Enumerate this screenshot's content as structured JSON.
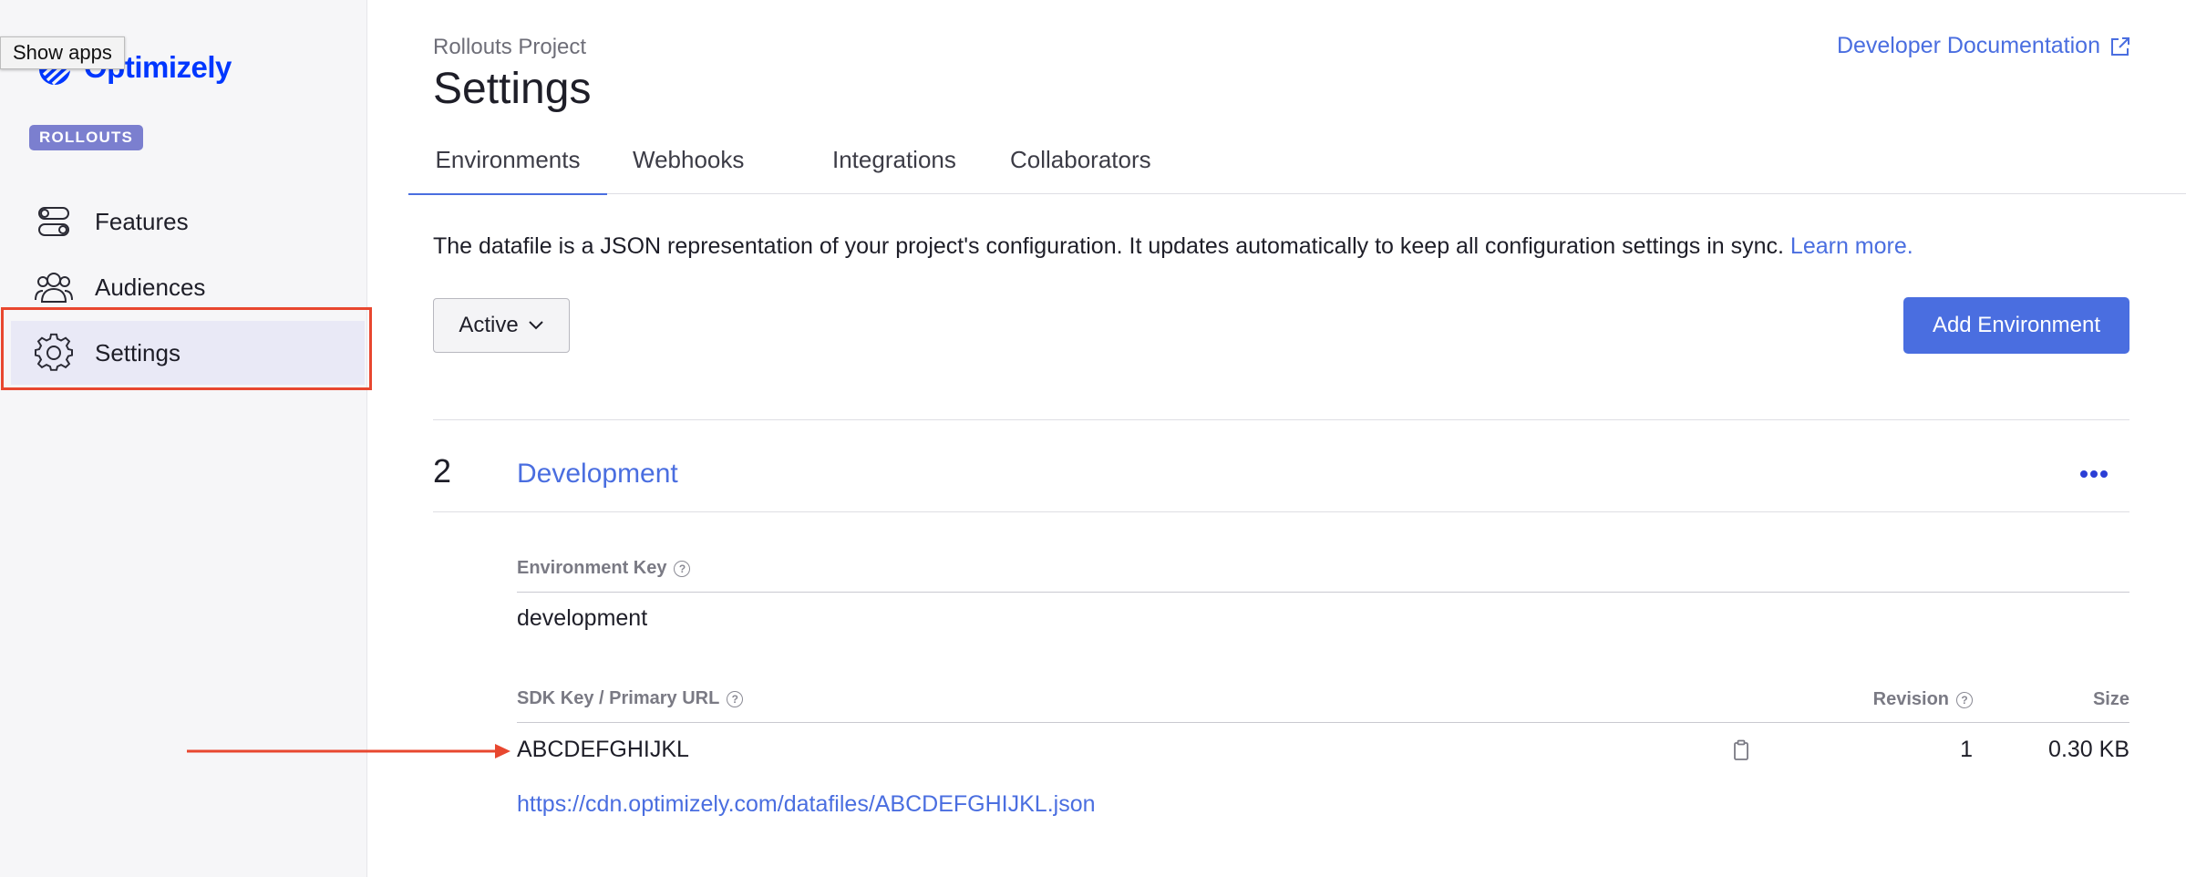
{
  "tooltip": "Show apps",
  "brand": {
    "name": "Optimizely",
    "badge": "ROLLOUTS",
    "color": "#0037ff"
  },
  "sidebar": {
    "items": [
      {
        "label": "Features",
        "icon": "toggles-icon",
        "active": false
      },
      {
        "label": "Audiences",
        "icon": "people-icon",
        "active": false
      },
      {
        "label": "Settings",
        "icon": "gear-icon",
        "active": true
      }
    ]
  },
  "header": {
    "project": "Rollouts Project",
    "title": "Settings",
    "doc_link": "Developer Documentation"
  },
  "tabs": [
    "Environments",
    "Webhooks",
    "Integrations",
    "Collaborators"
  ],
  "active_tab": "Environments",
  "intro": {
    "text": "The datafile is a JSON representation of your project's configuration. It updates automatically to keep all configuration settings in sync.",
    "link": "Learn more."
  },
  "filter": {
    "selected": "Active"
  },
  "add_button": "Add Environment",
  "environment": {
    "number": "2",
    "name": "Development",
    "key_label": "Environment Key",
    "key_value": "development",
    "sdk_label": "SDK Key / Primary URL",
    "revision_label": "Revision",
    "size_label": "Size",
    "sdk_key": "ABCDEFGHIJKL",
    "revision": "1",
    "size": "0.30 KB",
    "url": "https://cdn.optimizely.com/datafiles/ABCDEFGHIJKL.json"
  },
  "colors": {
    "accent": "#4a6ee0",
    "annotation": "#e8472f",
    "badge": "#7b7fcf"
  }
}
